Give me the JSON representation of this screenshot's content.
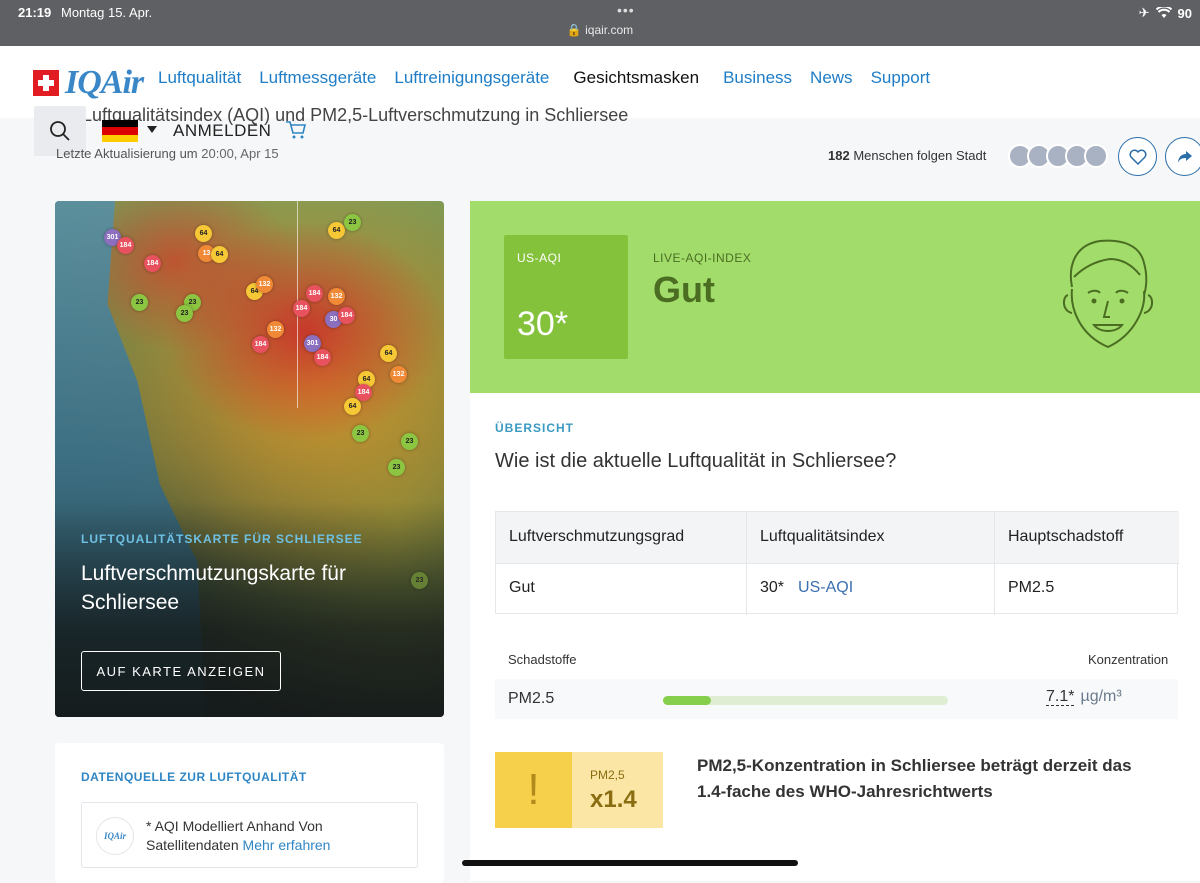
{
  "status_bar": {
    "time": "21:19",
    "date": "Montag 15. Apr.",
    "url": "iqair.com",
    "battery": "90"
  },
  "nav": {
    "logo": "IQAir",
    "links": [
      {
        "label": "Luftqualität"
      },
      {
        "label": "Luftmessgeräte"
      },
      {
        "label": "Luftreinigungsgeräte"
      },
      {
        "label": "Gesichtsmasken"
      },
      {
        "label": "Business"
      },
      {
        "label": "News"
      },
      {
        "label": "Support"
      }
    ],
    "login": "ANMELDEN"
  },
  "header": {
    "title_partial": "Luftqualitätsindex (AQI) und PM2,5-Luftverschmutzung in Schliersee",
    "updated_label": "Letzte Aktualisierung um",
    "updated_value": "20:00, Apr 15",
    "followers_count": "182",
    "followers_label": "Menschen folgen Stadt"
  },
  "map_card": {
    "eyebrow": "LUFTQUALITÄTSKARTE FÜR SCHLIERSEE",
    "title": "Luftverschmutzungskarte für Schliersee",
    "button": "AUF KARTE ANZEIGEN",
    "markers": [
      "301",
      "184",
      "184",
      "64",
      "13",
      "64",
      "64",
      "23",
      "23",
      "23",
      "23",
      "64",
      "132",
      "184",
      "132",
      "30",
      "184",
      "184",
      "132",
      "184",
      "301",
      "184",
      "64",
      "64",
      "132",
      "184",
      "64",
      "23",
      "23",
      "23"
    ]
  },
  "source_card": {
    "eyebrow": "DATENQUELLE ZUR LUFTQUALITÄT",
    "logo": "IQAir",
    "text": "* AQI Modelliert Anhand Von Satellitendaten",
    "link": "Mehr erfahren"
  },
  "aqi": {
    "box_label": "US-AQI",
    "box_value": "30*",
    "live_label": "LIVE-AQI-INDEX",
    "live_value": "Gut",
    "colors": {
      "header_bg": "#a2dc6a",
      "box_bg": "#84c23c",
      "text": "#4a6d22"
    }
  },
  "overview": {
    "eyebrow": "ÜBERSICHT",
    "question": "Wie ist die aktuelle Luftqualität in Schliersee?",
    "table": {
      "headers": [
        "Luftverschmutzungsgrad",
        "Luftqualitätsindex",
        "Hauptschadstoff"
      ],
      "row": {
        "level": "Gut",
        "index": "30*",
        "index_unit": "US-AQI",
        "pollutant": "PM2.5"
      }
    }
  },
  "pollutants": {
    "header_left": "Schadstoffe",
    "header_right": "Konzentration",
    "items": [
      {
        "name": "PM2.5",
        "value": "7.1*",
        "unit": "µg/m³",
        "fill_fraction": 0.17
      }
    ]
  },
  "warning": {
    "icon": "!",
    "label": "PM2,5",
    "value": "x1.4",
    "text": "PM2,5-Konzentration in Schliersee beträgt derzeit das 1.4-fache des WHO-Jahresrichtwerts"
  }
}
